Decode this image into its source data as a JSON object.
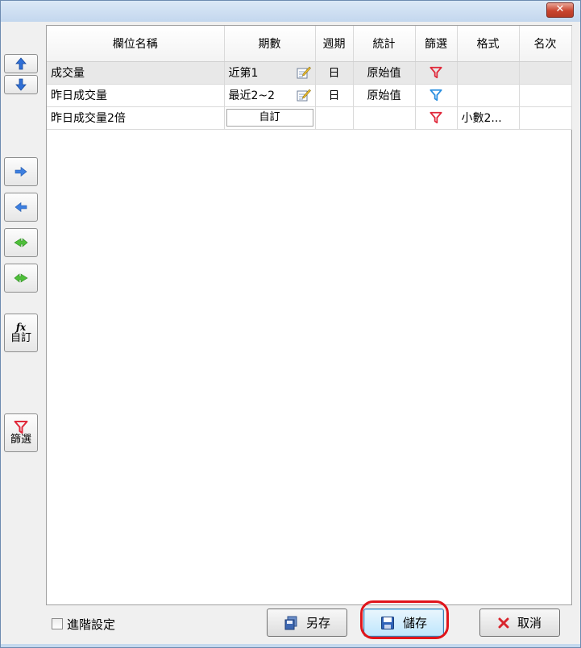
{
  "window": {
    "close_glyph": "✕"
  },
  "toolbar": {
    "buttons": [
      {
        "name": "move-up-icon"
      },
      {
        "name": "move-down-icon"
      },
      {
        "name": "move-right-icon"
      },
      {
        "name": "move-left-icon"
      },
      {
        "name": "move-all-left-icon"
      },
      {
        "name": "move-all-right-icon"
      }
    ],
    "custom": {
      "icon_text": "fx",
      "label": "自訂"
    },
    "filter": {
      "label": "篩選"
    }
  },
  "grid": {
    "headers": [
      "欄位名稱",
      "期數",
      "週期",
      "統計",
      "篩選",
      "格式",
      "名次"
    ],
    "rows": [
      {
        "name": "成交量",
        "period": "近第1",
        "cycle": "日",
        "stat": "原始值",
        "filter_color": "#e0283a",
        "format": "",
        "rank": "",
        "selected": true
      },
      {
        "name": "昨日成交量",
        "period": "最近2~2",
        "cycle": "日",
        "stat": "原始值",
        "filter_color": "#2a8fe0",
        "format": "",
        "rank": ""
      },
      {
        "name": "昨日成交量2倍",
        "period_button": "自訂",
        "cycle": "",
        "stat": "",
        "filter_color": "#e0283a",
        "format": "小數2...",
        "rank": ""
      }
    ]
  },
  "footer": {
    "advanced_label": "進階設定",
    "save_as_label": "另存",
    "save_label": "儲存",
    "cancel_label": "取消"
  },
  "colors": {
    "filter_red": "#e0283a",
    "filter_blue": "#2a8fe0",
    "highlight": "#e0151b"
  }
}
